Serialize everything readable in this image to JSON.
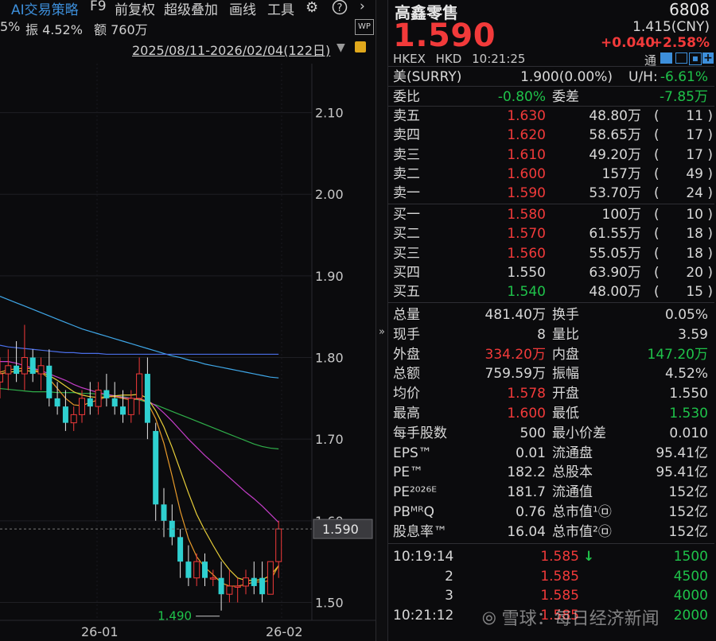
{
  "toolbar": {
    "ai_label": "AI交易策略",
    "f9": "F9",
    "adjust": "前复权",
    "overlay": "超级叠加",
    "draw": "画线",
    "tools": "工具",
    "gear_icon": "gear-icon",
    "help_icon": "help-icon",
    "collapse_icon": "chevron-right-icon"
  },
  "stats_line": {
    "pct_fragment": "5%",
    "amplitude": "振 4.52%",
    "turnover": "额 760万"
  },
  "date_range": "2025/08/11-2026/02/04(122日)",
  "wp_badge": "WP",
  "stock": {
    "name": "高鑫零售",
    "code": "6808",
    "price": "1.590",
    "cny_price": "1.415(CNY)",
    "change": "+0.040",
    "change_pct": "+2.58%",
    "exchange": "HKEX",
    "currency": "HKD",
    "time": "10:21:25",
    "tong": "通"
  },
  "summary": {
    "us_label": "美(SURRY)",
    "us_value": "1.900(0.00%)",
    "uh_label": "U/H:",
    "uh_value": "-6.61%",
    "weibi_label": "委比",
    "weibi_value": "-0.80%",
    "weicha_label": "委差",
    "weicha_value": "-7.85万"
  },
  "asks": [
    {
      "label": "卖五",
      "price": "1.630",
      "vol": "48.80万",
      "count": "11"
    },
    {
      "label": "卖四",
      "price": "1.620",
      "vol": "58.65万",
      "count": "17"
    },
    {
      "label": "卖三",
      "price": "1.610",
      "vol": "49.20万",
      "count": "17"
    },
    {
      "label": "卖二",
      "price": "1.600",
      "vol": "157万",
      "count": "49"
    },
    {
      "label": "卖一",
      "price": "1.590",
      "vol": "53.70万",
      "count": "24"
    }
  ],
  "bids": [
    {
      "label": "买一",
      "price": "1.580",
      "vol": "100万",
      "count": "10",
      "color": "red"
    },
    {
      "label": "买二",
      "price": "1.570",
      "vol": "61.55万",
      "count": "18",
      "color": "red"
    },
    {
      "label": "买三",
      "price": "1.560",
      "vol": "55.05万",
      "count": "18",
      "color": "red"
    },
    {
      "label": "买四",
      "price": "1.550",
      "vol": "63.90万",
      "count": "20",
      "color": "white"
    },
    {
      "label": "买五",
      "price": "1.540",
      "vol": "48.00万",
      "count": "15",
      "color": "green"
    }
  ],
  "quote": [
    {
      "l1": "总量",
      "v1": "481.40万",
      "c1": "white",
      "l2": "换手",
      "v2": "0.05%",
      "c2": "white"
    },
    {
      "l1": "现手",
      "v1": "8",
      "c1": "white",
      "l2": "量比",
      "v2": "3.59",
      "c2": "white"
    },
    {
      "l1": "外盘",
      "v1": "334.20万",
      "c1": "red",
      "l2": "内盘",
      "v2": "147.20万",
      "c2": "green"
    },
    {
      "l1": "总额",
      "v1": "759.59万",
      "c1": "white",
      "l2": "振幅",
      "v2": "4.52%",
      "c2": "white"
    },
    {
      "l1": "均价",
      "v1": "1.578",
      "c1": "red",
      "l2": "开盘",
      "v2": "1.550",
      "c2": "white"
    },
    {
      "l1": "最高",
      "v1": "1.600",
      "c1": "red",
      "l2": "最低",
      "v2": "1.530",
      "c2": "green"
    },
    {
      "l1": "每手股数",
      "v1": "500",
      "c1": "white",
      "l2": "最小价差",
      "v2": "0.010",
      "c2": "white"
    },
    {
      "l1": "EPS™",
      "v1": "0.01",
      "c1": "white",
      "l2": "流通盘",
      "v2": "95.41亿",
      "c2": "white"
    },
    {
      "l1": "PE™",
      "v1": "182.2",
      "c1": "white",
      "l2": "总股本",
      "v2": "95.41亿",
      "c2": "white"
    },
    {
      "l1": "PE²⁰²⁶ᴱ",
      "v1": "181.7",
      "c1": "white",
      "l2": "流通值",
      "v2": "152亿",
      "c2": "white"
    },
    {
      "l1": "PBᴹᴿQ",
      "v1": "0.76",
      "c1": "white",
      "l2": "总市值¹㉤",
      "v2": "152亿",
      "c2": "white"
    },
    {
      "l1": "股息率™",
      "v1": "16.04",
      "c1": "white",
      "l2": "总市值²㉤",
      "v2": "152亿",
      "c2": "white"
    }
  ],
  "ticks": [
    {
      "time": "10:19:14",
      "price": "1.585",
      "arrow": "down",
      "vol": "1500"
    },
    {
      "time": "2",
      "price": "1.585",
      "arrow": "",
      "vol": "4500"
    },
    {
      "time": "3",
      "price": "1.585",
      "arrow": "",
      "vol": "4000"
    },
    {
      "time": "10:21:12",
      "price": "1.585",
      "arrow": "",
      "vol": "2000"
    }
  ],
  "watermark": "雪球：每日经济新闻",
  "chart_data": {
    "type": "candlestick",
    "y_ticks": [
      "2.10",
      "2.00",
      "1.90",
      "1.80",
      "1.70",
      "1.60",
      "1.50"
    ],
    "x_ticks": [
      "26-01",
      "26-02"
    ],
    "last_price_label": "1.590",
    "low_marker": "1.490",
    "ylim": [
      1.48,
      2.16
    ],
    "candles": [
      {
        "o": 1.77,
        "h": 1.8,
        "l": 1.75,
        "c": 1.78
      },
      {
        "o": 1.78,
        "h": 1.81,
        "l": 1.76,
        "c": 1.79
      },
      {
        "o": 1.79,
        "h": 1.82,
        "l": 1.77,
        "c": 1.78
      },
      {
        "o": 1.78,
        "h": 1.84,
        "l": 1.76,
        "c": 1.8
      },
      {
        "o": 1.8,
        "h": 1.81,
        "l": 1.77,
        "c": 1.78
      },
      {
        "o": 1.78,
        "h": 1.8,
        "l": 1.76,
        "c": 1.79
      },
      {
        "o": 1.79,
        "h": 1.81,
        "l": 1.74,
        "c": 1.75
      },
      {
        "o": 1.75,
        "h": 1.77,
        "l": 1.73,
        "c": 1.74
      },
      {
        "o": 1.74,
        "h": 1.76,
        "l": 1.71,
        "c": 1.72
      },
      {
        "o": 1.72,
        "h": 1.74,
        "l": 1.71,
        "c": 1.73
      },
      {
        "o": 1.73,
        "h": 1.76,
        "l": 1.72,
        "c": 1.75
      },
      {
        "o": 1.75,
        "h": 1.77,
        "l": 1.73,
        "c": 1.74
      },
      {
        "o": 1.74,
        "h": 1.77,
        "l": 1.73,
        "c": 1.76
      },
      {
        "o": 1.76,
        "h": 1.78,
        "l": 1.74,
        "c": 1.75
      },
      {
        "o": 1.75,
        "h": 1.77,
        "l": 1.73,
        "c": 1.74
      },
      {
        "o": 1.74,
        "h": 1.76,
        "l": 1.72,
        "c": 1.73
      },
      {
        "o": 1.73,
        "h": 1.76,
        "l": 1.72,
        "c": 1.75
      },
      {
        "o": 1.75,
        "h": 1.8,
        "l": 1.73,
        "c": 1.78
      },
      {
        "o": 1.78,
        "h": 1.8,
        "l": 1.7,
        "c": 1.72
      },
      {
        "o": 1.71,
        "h": 1.72,
        "l": 1.6,
        "c": 1.62
      },
      {
        "o": 1.62,
        "h": 1.64,
        "l": 1.58,
        "c": 1.6
      },
      {
        "o": 1.6,
        "h": 1.62,
        "l": 1.57,
        "c": 1.58
      },
      {
        "o": 1.58,
        "h": 1.59,
        "l": 1.53,
        "c": 1.55
      },
      {
        "o": 1.55,
        "h": 1.57,
        "l": 1.52,
        "c": 1.53
      },
      {
        "o": 1.53,
        "h": 1.56,
        "l": 1.52,
        "c": 1.55
      },
      {
        "o": 1.55,
        "h": 1.56,
        "l": 1.52,
        "c": 1.53
      },
      {
        "o": 1.53,
        "h": 1.54,
        "l": 1.52,
        "c": 1.53
      },
      {
        "o": 1.53,
        "h": 1.55,
        "l": 1.49,
        "c": 1.51
      },
      {
        "o": 1.51,
        "h": 1.54,
        "l": 1.5,
        "c": 1.52
      },
      {
        "o": 1.52,
        "h": 1.53,
        "l": 1.5,
        "c": 1.52
      },
      {
        "o": 1.52,
        "h": 1.54,
        "l": 1.51,
        "c": 1.53
      },
      {
        "o": 1.53,
        "h": 1.55,
        "l": 1.51,
        "c": 1.52
      },
      {
        "o": 1.53,
        "h": 1.55,
        "l": 1.5,
        "c": 1.51
      },
      {
        "o": 1.51,
        "h": 1.55,
        "l": 1.51,
        "c": 1.55
      },
      {
        "o": 1.55,
        "h": 1.6,
        "l": 1.53,
        "c": 1.59
      }
    ],
    "ma_lines": [
      {
        "color": "#3fa7e8",
        "values": [
          1.875,
          1.871,
          1.867,
          1.863,
          1.859,
          1.855,
          1.851,
          1.847,
          1.843,
          1.839,
          1.835,
          1.832,
          1.829,
          1.826,
          1.823,
          1.82,
          1.817,
          1.814,
          1.811,
          1.808,
          1.805,
          1.802,
          1.8,
          1.797,
          1.795,
          1.792,
          1.79,
          1.788,
          1.786,
          1.784,
          1.782,
          1.78,
          1.778,
          1.776,
          1.775
        ]
      },
      {
        "color": "#4a6ee8",
        "values": [
          1.815,
          1.813,
          1.812,
          1.811,
          1.81,
          1.809,
          1.808,
          1.807,
          1.806,
          1.806,
          1.805,
          1.805,
          1.805,
          1.804,
          1.804,
          1.804,
          1.804,
          1.804,
          1.804,
          1.804,
          1.804,
          1.804,
          1.804,
          1.804,
          1.804,
          1.804,
          1.804,
          1.804,
          1.804,
          1.804,
          1.804,
          1.804,
          1.804,
          1.804,
          1.804
        ]
      },
      {
        "color": "#2fae4a",
        "values": [
          1.762,
          1.761,
          1.76,
          1.759,
          1.758,
          1.758,
          1.758,
          1.757,
          1.757,
          1.757,
          1.756,
          1.756,
          1.755,
          1.754,
          1.753,
          1.752,
          1.75,
          1.748,
          1.745,
          1.742,
          1.738,
          1.734,
          1.73,
          1.726,
          1.722,
          1.718,
          1.714,
          1.71,
          1.706,
          1.702,
          1.698,
          1.694,
          1.691,
          1.689,
          1.688
        ]
      },
      {
        "color": "#c43ec8",
        "values": [
          1.795,
          1.795,
          1.793,
          1.79,
          1.787,
          1.784,
          1.78,
          1.776,
          1.772,
          1.767,
          1.763,
          1.76,
          1.757,
          1.755,
          1.753,
          1.751,
          1.75,
          1.749,
          1.747,
          1.741,
          1.732,
          1.722,
          1.711,
          1.7,
          1.69,
          1.68,
          1.671,
          1.662,
          1.653,
          1.644,
          1.635,
          1.627,
          1.618,
          1.608,
          1.598
        ]
      },
      {
        "color": "#e8cf3a",
        "values": [
          1.78,
          1.782,
          1.783,
          1.784,
          1.783,
          1.782,
          1.778,
          1.772,
          1.765,
          1.758,
          1.754,
          1.752,
          1.751,
          1.752,
          1.753,
          1.754,
          1.754,
          1.755,
          1.75,
          1.735,
          1.715,
          1.69,
          1.662,
          1.634,
          1.608,
          1.588,
          1.57,
          1.553,
          1.54,
          1.53,
          1.527,
          1.527,
          1.528,
          1.533,
          1.545
        ]
      },
      {
        "color": "#e89a2a",
        "values": [
          1.782,
          1.785,
          1.786,
          1.787,
          1.786,
          1.782,
          1.774,
          1.762,
          1.75,
          1.742,
          1.741,
          1.745,
          1.748,
          1.752,
          1.752,
          1.75,
          1.748,
          1.75,
          1.745,
          1.725,
          1.695,
          1.655,
          1.612,
          1.578,
          1.556,
          1.543,
          1.534,
          1.524,
          1.52,
          1.52,
          1.522,
          1.525,
          1.525,
          1.527,
          1.545
        ]
      }
    ]
  }
}
